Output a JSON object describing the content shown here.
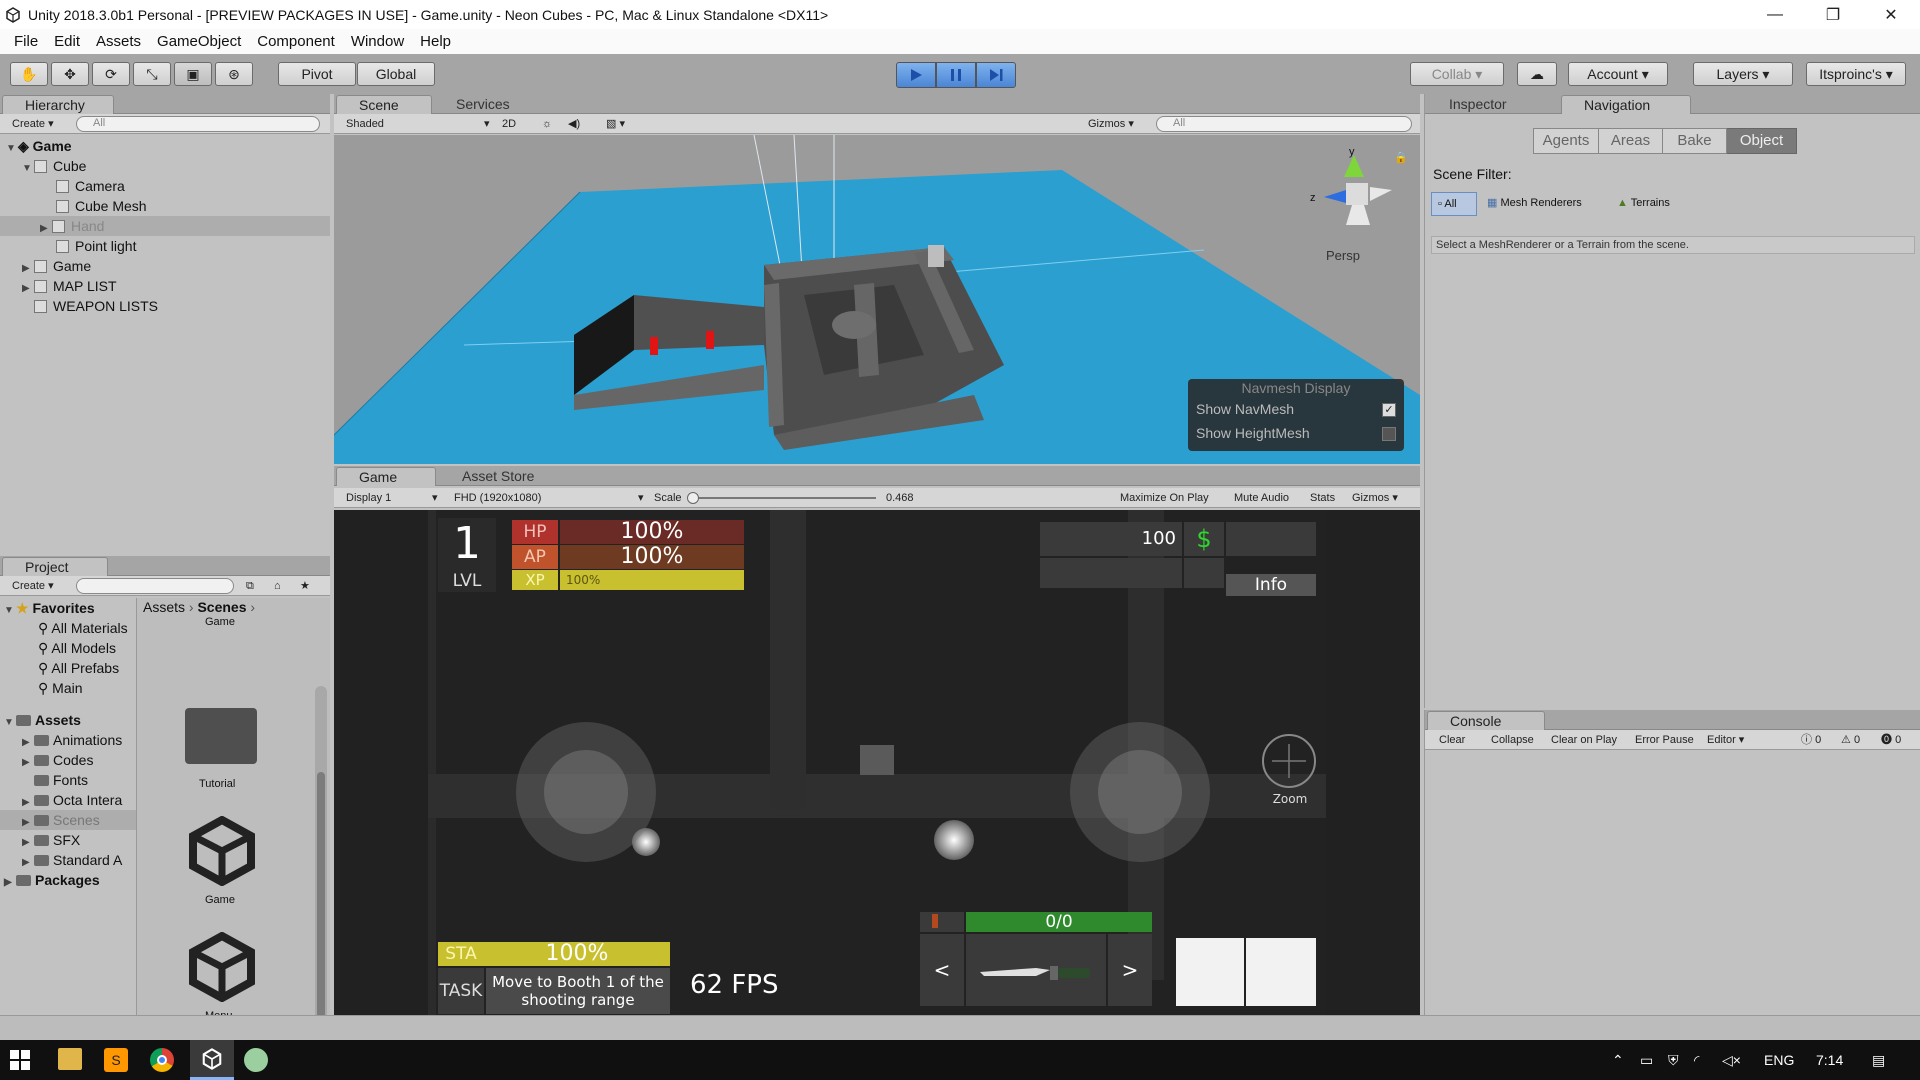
{
  "window": {
    "title": "Unity 2018.3.0b1 Personal - [PREVIEW PACKAGES IN USE] - Game.unity - Neon Cubes - PC, Mac & Linux Standalone <DX11>",
    "minimize": "—",
    "maximize": "❐",
    "close": "✕"
  },
  "menu": [
    "File",
    "Edit",
    "Assets",
    "GameObject",
    "Component",
    "Window",
    "Help"
  ],
  "toolbar": {
    "pivot": "Pivot",
    "global": "Global",
    "collab": "Collab",
    "account": "Account",
    "layers": "Layers",
    "layout": "Itsproinc's"
  },
  "hierarchy": {
    "tab": "Hierarchy",
    "create": "Create",
    "search_placeholder": "All",
    "scene": "Game",
    "items": [
      "Cube",
      "Camera",
      "Cube Mesh",
      "Hand",
      "Point light",
      "Game",
      "MAP LIST",
      "WEAPON LISTS"
    ]
  },
  "scene": {
    "tab": "Scene",
    "services": "Services",
    "shading": "Shaded",
    "mode2d": "2D",
    "gizmos": "Gizmos",
    "search_placeholder": "All",
    "persp": "Persp",
    "axis_y": "y",
    "axis_z": "z",
    "navmesh": {
      "title": "Navmesh Display",
      "show_navmesh": "Show NavMesh",
      "show_heightmesh": "Show HeightMesh"
    }
  },
  "game": {
    "tab": "Game",
    "asset_store": "Asset Store",
    "display": "Display 1",
    "resolution": "FHD (1920x1080)",
    "scale_label": "Scale",
    "scale_value": "0.468",
    "scale_fraction": 0.0,
    "maximize": "Maximize On Play",
    "mute": "Mute Audio",
    "stats": "Stats",
    "gizmos": "Gizmos"
  },
  "hud": {
    "level": "1",
    "lvl_label": "LVL",
    "hp_label": "HP",
    "hp_value": "100%",
    "ap_label": "AP",
    "ap_value": "100%",
    "xp_label": "XP",
    "xp_value": "100%",
    "money": "100",
    "currency": "$",
    "info": "Info",
    "zoom": "Zoom",
    "sta_label": "STA",
    "sta_value": "100%",
    "task_label": "TASK",
    "task_text": "Move to Booth 1 of the shooting range",
    "fps": "62 FPS",
    "ammo": "0/0",
    "prev": "<",
    "next": ">"
  },
  "inspector": {
    "tab": "Inspector",
    "navigation": "Navigation",
    "subtabs": [
      "Agents",
      "Areas",
      "Bake",
      "Object"
    ],
    "scene_filter": "Scene Filter:",
    "filters": [
      "All",
      "Mesh Renderers",
      "Terrains"
    ],
    "hint": "Select a MeshRenderer or a Terrain from the scene."
  },
  "project": {
    "tab": "Project",
    "create": "Create",
    "favorites": "Favorites",
    "fav_items": [
      "All Materials",
      "All Models",
      "All Prefabs",
      "Main"
    ],
    "assets": "Assets",
    "asset_items": [
      "Animations",
      "Codes",
      "Fonts",
      "Octa Intera",
      "Scenes",
      "SFX",
      "Standard A"
    ],
    "packages": "Packages",
    "breadcrumb_root": "Assets",
    "breadcrumb_current": "Scenes",
    "grid_items": [
      "Game",
      "Tutorial",
      "Game",
      "Menu"
    ]
  },
  "console": {
    "tab": "Console",
    "buttons": [
      "Clear",
      "Collapse",
      "Clear on Play",
      "Error Pause",
      "Editor"
    ],
    "counts": [
      "0",
      "0",
      "0"
    ]
  },
  "taskbar": {
    "lang": "ENG",
    "time": "7:14"
  },
  "colors": {
    "editor_bg": "#c2c2c2",
    "nav_blue": "#2a9fd0",
    "hp_red": "#b0322c",
    "ap_orange": "#c0522c",
    "xp_yellow": "#c8c02e",
    "ammo_green": "#2f8a2e",
    "money_green": "#2fd62f"
  }
}
